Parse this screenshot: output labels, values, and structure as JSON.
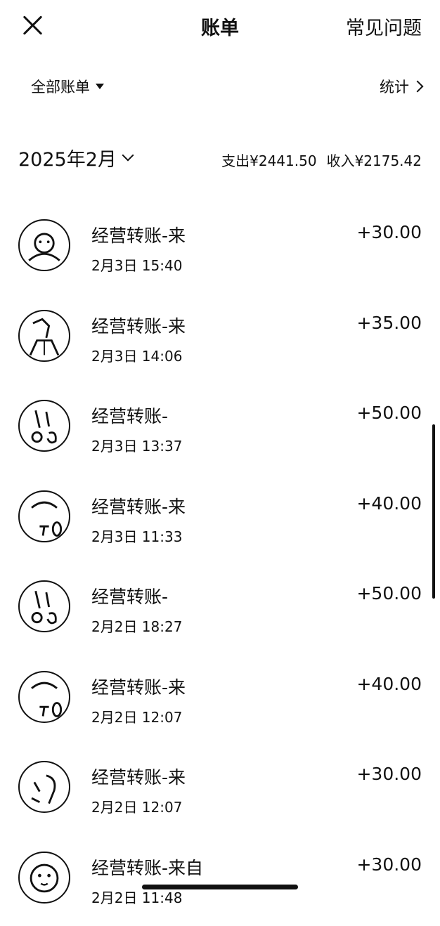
{
  "header": {
    "title": "账单",
    "faq_label": "常见问题",
    "close_icon": "close-icon"
  },
  "filter": {
    "all_bills_label": "全部账单",
    "stats_label": "统计"
  },
  "month": {
    "label": "2025年2月",
    "expense_label": "支出",
    "expense_value": "¥2441.50",
    "income_label": "收入",
    "income_value": "¥2175.42"
  },
  "transactions": [
    {
      "title": "经营转账-来",
      "time": "2月3日 15:40",
      "amount": "+30.00"
    },
    {
      "title": "经营转账-来",
      "time": "2月3日 14:06",
      "amount": "+35.00"
    },
    {
      "title": "经营转账-",
      "time": "2月3日 13:37",
      "amount": "+50.00"
    },
    {
      "title": "经营转账-来",
      "time": "2月3日 11:33",
      "amount": "+40.00"
    },
    {
      "title": "经营转账-",
      "time": "2月2日 18:27",
      "amount": "+50.00"
    },
    {
      "title": "经营转账-来",
      "time": "2月2日 12:07",
      "amount": "+40.00"
    },
    {
      "title": "经营转账-来",
      "time": "2月2日 12:07",
      "amount": "+30.00"
    },
    {
      "title": "经营转账-来自",
      "time": "2月2日 11:48",
      "amount": "+30.00"
    }
  ]
}
